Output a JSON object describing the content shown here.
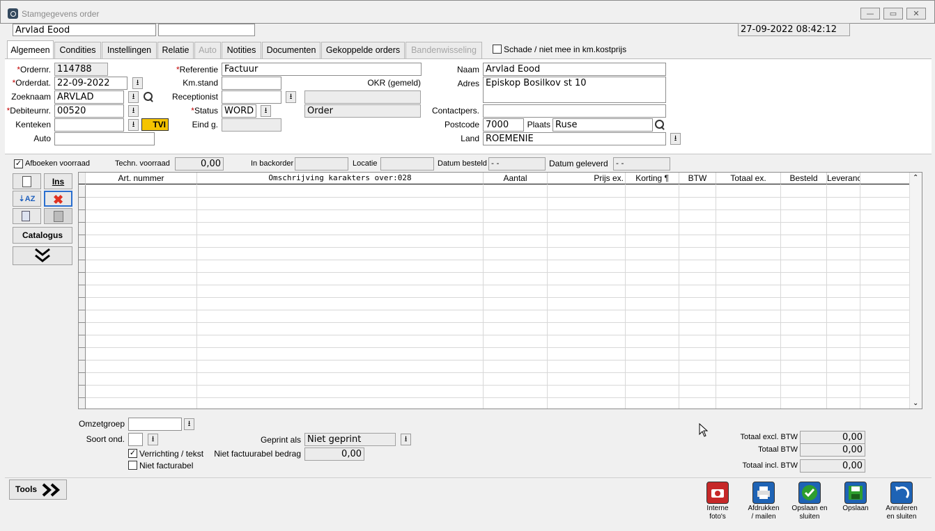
{
  "window": {
    "title": "Stamgegevens order",
    "minimize": "—",
    "restore": "▭",
    "close": "✕"
  },
  "header": {
    "customer_name": "Arvlad Eood",
    "second_field": "",
    "datetime": "27-09-2022 08:42:12"
  },
  "tabs": [
    "Algemeen",
    "Condities",
    "Instellingen",
    "Relatie",
    "Auto",
    "Notities",
    "Documenten",
    "Gekoppelde orders",
    "Bandenwisseling"
  ],
  "damage_checkbox": {
    "label": "Schade / niet mee in km.kostprijs",
    "checked": false
  },
  "left": {
    "ordernr_label": "Ordernr.",
    "ordernr": "114788",
    "orderdat_label": "Orderdat.",
    "orderdat": "22-09-2022",
    "zoeknaam_label": "Zoeknaam",
    "zoeknaam": "ARVLAD",
    "debiteurnr_label": "Debiteurnr.",
    "debiteurnr": "00520",
    "kenteken_label": "Kenteken",
    "kenteken": "",
    "auto_label": "Auto",
    "auto": "",
    "tvi_badge": "TVI"
  },
  "middle": {
    "referentie_label": "Referentie",
    "referentie": "Factuur",
    "kmstand_label": "Km.stand",
    "kmstand": "",
    "okr_label": "OKR (gemeld)",
    "receptionist_label": "Receptionist",
    "receptionist": "",
    "receptionist_extra": "",
    "status_label": "Status",
    "status": "WORD",
    "status_text": "Order",
    "eindg_label": "Eind g.",
    "eindg": ""
  },
  "relation": {
    "naam_label": "Naam",
    "naam": "Arvlad Eood",
    "adres_label": "Adres",
    "adres": "Episkop Bosilkov st 10",
    "contactpers_label": "Contactpers.",
    "contactpers": "",
    "postcode_label": "Postcode",
    "postcode": "7000",
    "plaats_label": "Plaats",
    "plaats": "Ruse",
    "land_label": "Land",
    "land": "ROEMENIE"
  },
  "stockbar": {
    "afboeken_label": "Afboeken voorraad",
    "afboeken_checked": true,
    "techn_label": "Techn. voorraad",
    "techn": "0,00",
    "backorder_label": "In backorder",
    "backorder": "",
    "locatie_label": "Locatie",
    "locatie": "",
    "datum_besteld_label": "Datum besteld",
    "datum_besteld": "  -  -",
    "datum_geleverd_label": "Datum geleverd",
    "datum_geleverd": "  -  -"
  },
  "toolbox": {
    "ins": "Ins",
    "catalogus": "Catalogus",
    "more": "⌄⌄"
  },
  "grid": {
    "columns": [
      "Art. nummer",
      "Omschrijving karakters over:028",
      "Aantal",
      "Prijs ex.",
      "Korting ¶",
      "BTW",
      "Totaal ex.",
      "Besteld",
      "Leveranc"
    ],
    "row_count": 18
  },
  "bottom": {
    "omzetgroep_label": "Omzetgroep",
    "omzetgroep": "",
    "soortond_label": "Soort ond.",
    "soortond": "",
    "verrichting_label": "Verrichting / tekst",
    "verrichting_checked": true,
    "nietfact_label": "Niet facturabel",
    "nietfact_checked": false,
    "geprint_label": "Geprint als",
    "geprint": "Niet geprint",
    "nietfactbedrag_label": "Niet factuurabel bedrag",
    "nietfactbedrag": "0,00",
    "totaal_excl_label": "Totaal excl. BTW",
    "totaal_excl": "0,00",
    "totaal_btw_label": "Totaal BTW",
    "totaal_btw": "0,00",
    "totaal_incl_label": "Totaal incl. BTW",
    "totaal_incl": "0,00"
  },
  "footer": {
    "tools": "Tools",
    "buttons": [
      "Interne\nfoto's",
      "Afdrukken\n/ mailen",
      "Opslaan en\nsluiten",
      "Opslaan",
      "Annuleren\nen sluiten"
    ]
  }
}
